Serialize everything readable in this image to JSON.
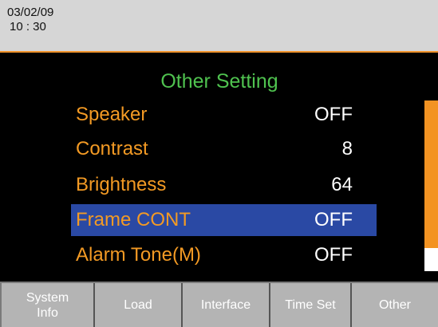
{
  "header": {
    "date": "03/02/09",
    "time": "10 : 30"
  },
  "menu": {
    "title": "Other Setting",
    "items": [
      {
        "label": "Speaker",
        "value": "OFF"
      },
      {
        "label": "Contrast",
        "value": "8"
      },
      {
        "label": "Brightness",
        "value": "64"
      },
      {
        "label": "Frame CONT",
        "value": "OFF",
        "selected": true
      },
      {
        "label": "Alarm Tone(M)",
        "value": "OFF"
      }
    ]
  },
  "scrollbar": {
    "position_fraction": 0.0,
    "visible_fraction": 0.86
  },
  "softkeys": [
    {
      "label_line1": "System",
      "label_line2": "Info"
    },
    {
      "label": "Load"
    },
    {
      "label": "Interface"
    },
    {
      "label": "Time Set"
    },
    {
      "label": "Other"
    }
  ],
  "colors": {
    "header_bg": "#d6d6d6",
    "accent_orange": "#f39a24",
    "title_green": "#4fc24f",
    "selection_blue": "#2a49a4",
    "screen_bg": "#000000",
    "softkey_bg": "#b4b4b4"
  }
}
